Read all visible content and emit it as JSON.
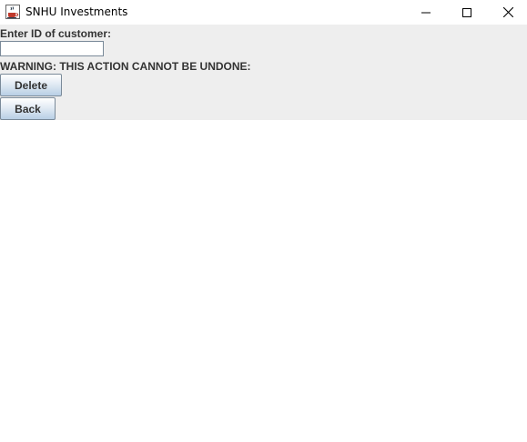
{
  "window": {
    "title": "SNHU Investments",
    "app_icon": "java-coffee-cup-icon",
    "controls": [
      "minimize-icon",
      "maximize-icon",
      "close-icon"
    ]
  },
  "form": {
    "customer_id_label": "Enter ID of customer:",
    "customer_id_value": "",
    "warning_text": "WARNING: THIS ACTION CANNOT BE UNDONE:",
    "delete_label": "Delete",
    "back_label": "Back"
  },
  "colors": {
    "panel_background": "#eeeeee",
    "button_gradient_top": "#ffffff",
    "button_gradient_bottom": "#b8cfe5",
    "button_border": "#7a8a99",
    "label_text": "#333333"
  }
}
